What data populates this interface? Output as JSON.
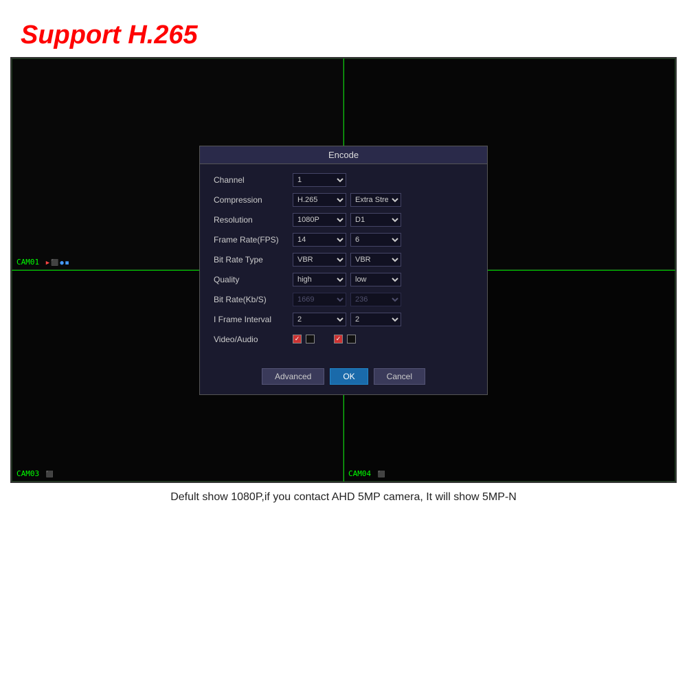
{
  "header": {
    "support_text": "Support ",
    "h265_text": "H.265"
  },
  "dialog": {
    "title": "Encode",
    "fields": {
      "channel": {
        "label": "Channel",
        "value1": "1"
      },
      "compression": {
        "label": "Compression",
        "value1": "H.265",
        "value2": "Extra Stream"
      },
      "resolution": {
        "label": "Resolution",
        "value1": "1080P",
        "value2": "D1"
      },
      "frame_rate": {
        "label": "Frame Rate(FPS)",
        "value1": "14",
        "value2": "6"
      },
      "bit_rate_type": {
        "label": "Bit Rate Type",
        "value1": "VBR",
        "value2": "VBR"
      },
      "quality": {
        "label": "Quality",
        "value1": "high",
        "value2": "low"
      },
      "bit_rate_kb": {
        "label": "Bit Rate(Kb/S)",
        "value1": "1669",
        "value2": "236"
      },
      "i_frame_interval": {
        "label": "I Frame Interval",
        "value1": "2",
        "value2": "2"
      },
      "video_audio": {
        "label": "Video/Audio"
      }
    },
    "buttons": {
      "advanced": "Advanced",
      "ok": "OK",
      "cancel": "Cancel"
    }
  },
  "cameras": {
    "cam01_label": "CAM01",
    "cam03_label": "CAM03",
    "cam04_label": "CAM04"
  },
  "footer": {
    "caption": "Defult show 1080P,if you contact AHD 5MP camera, It will show 5MP-N"
  }
}
